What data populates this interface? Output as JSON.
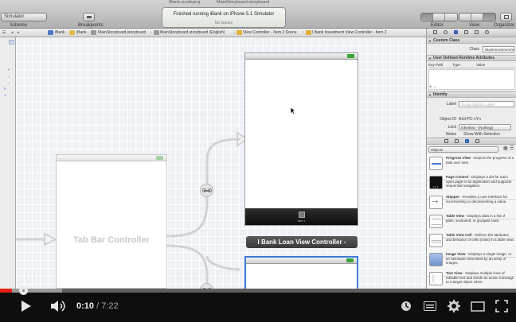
{
  "toolbar": {
    "scheme_popup": "Simulator",
    "scheme_label": "Scheme",
    "breakpoints_label": "Breakpoints",
    "ghost_tab_1": "iBank.xcodeproj",
    "ghost_tab_2": "MainStoryboard.storyboard",
    "activity_status": "Finished running iBank on iPhone 5.1 Simulator",
    "activity_issues": "No Issues",
    "editor_label": "Editor",
    "view_label": "View",
    "organizer_label": "Organizer"
  },
  "jumpbar": {
    "crumbs": [
      "iBank",
      "iBank",
      "MainStoryboard.storyboard",
      "MainStoryboard.storyboard (English)",
      "View Controller - Item 2 Scene",
      "I Bank Investment View Controller - Item 2"
    ]
  },
  "canvas": {
    "tab_bar_controller": "Tab Bar Controller",
    "tabbar_item_label": "Item 1",
    "loan_scene_title": "I Bank Loan View Controller -"
  },
  "inspector": {
    "custom_class_header": "Custom Class",
    "class_label": "Class",
    "class_value": "IBankInvestmentView",
    "runtime_header": "User Defined Runtime Attributes",
    "rt_col_keypath": "Key Path",
    "rt_col_type": "Type",
    "rt_col_value": "Value",
    "identity_header": "Identity",
    "label_label": "Label",
    "label_placeholder": "Xcode Specific Label",
    "object_id_label": "Object ID",
    "object_id_value": "A1d-PC-vYn",
    "lock_label": "Lock",
    "lock_value": "Inherited - (Nothing)",
    "notes_label": "Notes",
    "notes_value": "Show With Selection",
    "library_select": "Objects",
    "swatch_colors": [
      "#e35d5d",
      "#f0a24a",
      "#f2d94c",
      "#77c25a",
      "#6aa6e0",
      "#a47ad8",
      "#aaaaaa"
    ]
  },
  "library": [
    {
      "title": "Progress View",
      "desc": " - Depicts the progress of a task over time."
    },
    {
      "title": "Page Control",
      "desc": " - Displays a dot for each open page in an application and supports sequential navigation."
    },
    {
      "title": "Stepper",
      "desc": " - Provides a user interface for incrementing or decrementing a value."
    },
    {
      "title": "Table View",
      "desc": " - Displays data in a list of plain, sectioned, or grouped rows."
    },
    {
      "title": "Table View Cell",
      "desc": " - Defines the attributes and behavior of cells (rows) in a table view."
    },
    {
      "title": "Image View",
      "desc": " - Displays a single image, or an animation described by an array of images."
    },
    {
      "title": "Text View",
      "desc": " - Displays multiple lines of editable text and sends an action message to a target object when."
    }
  ],
  "player": {
    "current_time": "0:10",
    "duration": "7:22",
    "played_fraction": 0.023,
    "buffered_fraction": 0.12,
    "colors": {
      "played": "#e62117",
      "background": "#0e0e0e"
    }
  }
}
